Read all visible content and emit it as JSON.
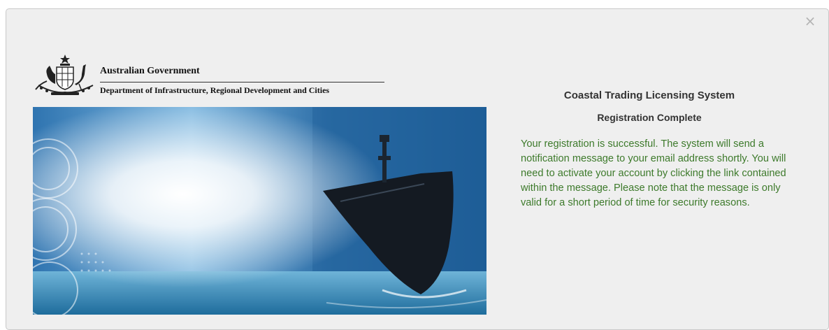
{
  "dialog": {
    "close_label": "×",
    "header": {
      "logo_icon": "australian-coat-of-arms-icon",
      "government": "Australian Government",
      "department": "Department of Infrastructure, Regional Development and Cities"
    },
    "banner_image": "ship-banner",
    "system_title": "Coastal Trading Licensing System",
    "registration_title": "Registration Complete",
    "message": "Your registration is successful. The system will send a notification message to your email address shortly. You will need to activate your account by clicking the link contained within the message. Please note that the message is only valid for a short period of time for security reasons.",
    "colors": {
      "message": "#3d7a2b",
      "background": "#efefef"
    }
  }
}
